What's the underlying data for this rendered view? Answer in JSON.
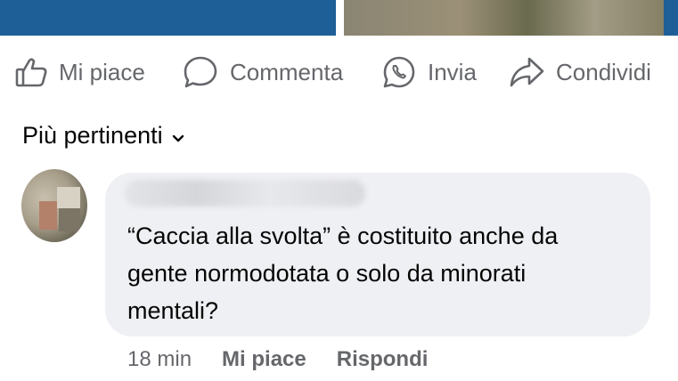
{
  "actions": {
    "like": {
      "label": "Mi piace",
      "icon": "thumbs-up-icon"
    },
    "comment": {
      "label": "Commenta",
      "icon": "speech-bubble-icon"
    },
    "send": {
      "label": "Invia",
      "icon": "whatsapp-icon"
    },
    "share": {
      "label": "Condividi",
      "icon": "share-arrow-icon"
    }
  },
  "sort": {
    "label": "Più pertinenti",
    "icon": "chevron-down-icon"
  },
  "comment": {
    "text": "“Caccia alla svolta” è costituito anche da\ngente normodotata o solo da minorati\nmentali?",
    "time": "18 min",
    "like_label": "Mi piace",
    "reply_label": "Rispondi"
  },
  "colors": {
    "secondary_text": "#65676b",
    "bubble_bg": "#eff0f3",
    "photo_blue": "#1f5f97"
  }
}
